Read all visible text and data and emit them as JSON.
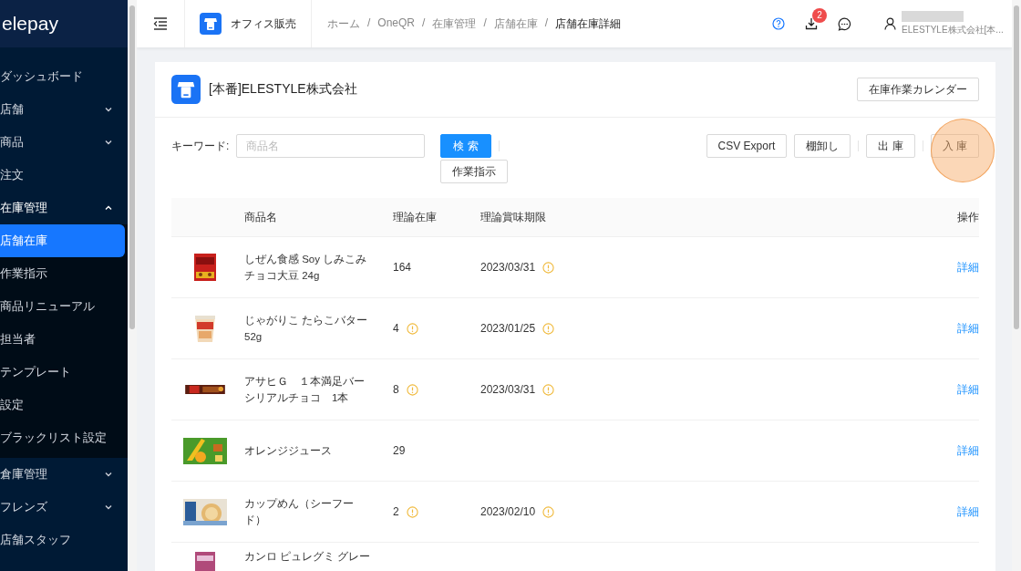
{
  "sidebar": {
    "logo": "elepay",
    "items": [
      {
        "label": "ダッシュボード",
        "kind": "link"
      },
      {
        "label": "店舗",
        "kind": "group",
        "expanded": false
      },
      {
        "label": "商品",
        "kind": "group",
        "expanded": false
      },
      {
        "label": "注文",
        "kind": "link"
      },
      {
        "label": "在庫管理",
        "kind": "group",
        "expanded": true,
        "children": [
          {
            "label": "店舗在庫",
            "selected": true
          },
          {
            "label": "作業指示",
            "selected": false
          },
          {
            "label": "商品リニューアル",
            "selected": false
          },
          {
            "label": "担当者",
            "selected": false
          },
          {
            "label": "テンプレート",
            "selected": false
          },
          {
            "label": "設定",
            "selected": false
          },
          {
            "label": "ブラックリスト設定",
            "selected": false
          }
        ]
      },
      {
        "label": "倉庫管理",
        "kind": "group",
        "expanded": false
      },
      {
        "label": "フレンズ",
        "kind": "group",
        "expanded": false
      },
      {
        "label": "店舗スタッフ",
        "kind": "link"
      }
    ]
  },
  "header": {
    "store": "オフィス販売",
    "breadcrumb": [
      {
        "label": "ホーム"
      },
      {
        "separator": "/",
        "label": "OneQR"
      },
      {
        "separator": "/",
        "label": "在庫管理"
      },
      {
        "separator": "/",
        "label": "店舗在庫"
      },
      {
        "separator": "/",
        "label": "店舗在庫詳細"
      }
    ],
    "download_badge": "2",
    "user_company": "ELESTYLE株式会社[本..."
  },
  "card": {
    "title": "[本番]ELESTYLE株式会社",
    "calendar_button": "在庫作業カレンダー",
    "keyword_label": "キーワード:",
    "search": {
      "placeholder": "商品名"
    },
    "search_button": "検 索",
    "instruction_button": "作業指示",
    "action_buttons": [
      "CSV Export",
      "棚卸し",
      "出 庫",
      "入 庫"
    ],
    "table": {
      "columns": [
        "商品名",
        "理論在庫",
        "理論賞味期限",
        "操作"
      ],
      "rows": [
        {
          "name": "しぜん食感 Soy しみこみチョコ大豆 24g",
          "stock": "164",
          "stock_warning": false,
          "expiry": "2023/03/31",
          "expiry_warning": true,
          "action": "詳細"
        },
        {
          "name": "じゃがりこ たらこバター 52g",
          "stock": "4",
          "stock_warning": true,
          "expiry": "2023/01/25",
          "expiry_warning": true,
          "action": "詳細"
        },
        {
          "name": "アサヒＧ　１本満足バーシリアルチョコ　1本",
          "stock": "8",
          "stock_warning": true,
          "expiry": "2023/03/31",
          "expiry_warning": true,
          "action": "詳細"
        },
        {
          "name": "オレンジジュース",
          "stock": "29",
          "stock_warning": false,
          "action": "詳細"
        },
        {
          "name": "カップめん（シーフード）",
          "stock": "2",
          "stock_warning": true,
          "expiry": "2023/02/10",
          "expiry_warning": true,
          "action": "詳細"
        },
        {
          "name": "カンロ ピュレグミ グレー"
        }
      ]
    }
  }
}
